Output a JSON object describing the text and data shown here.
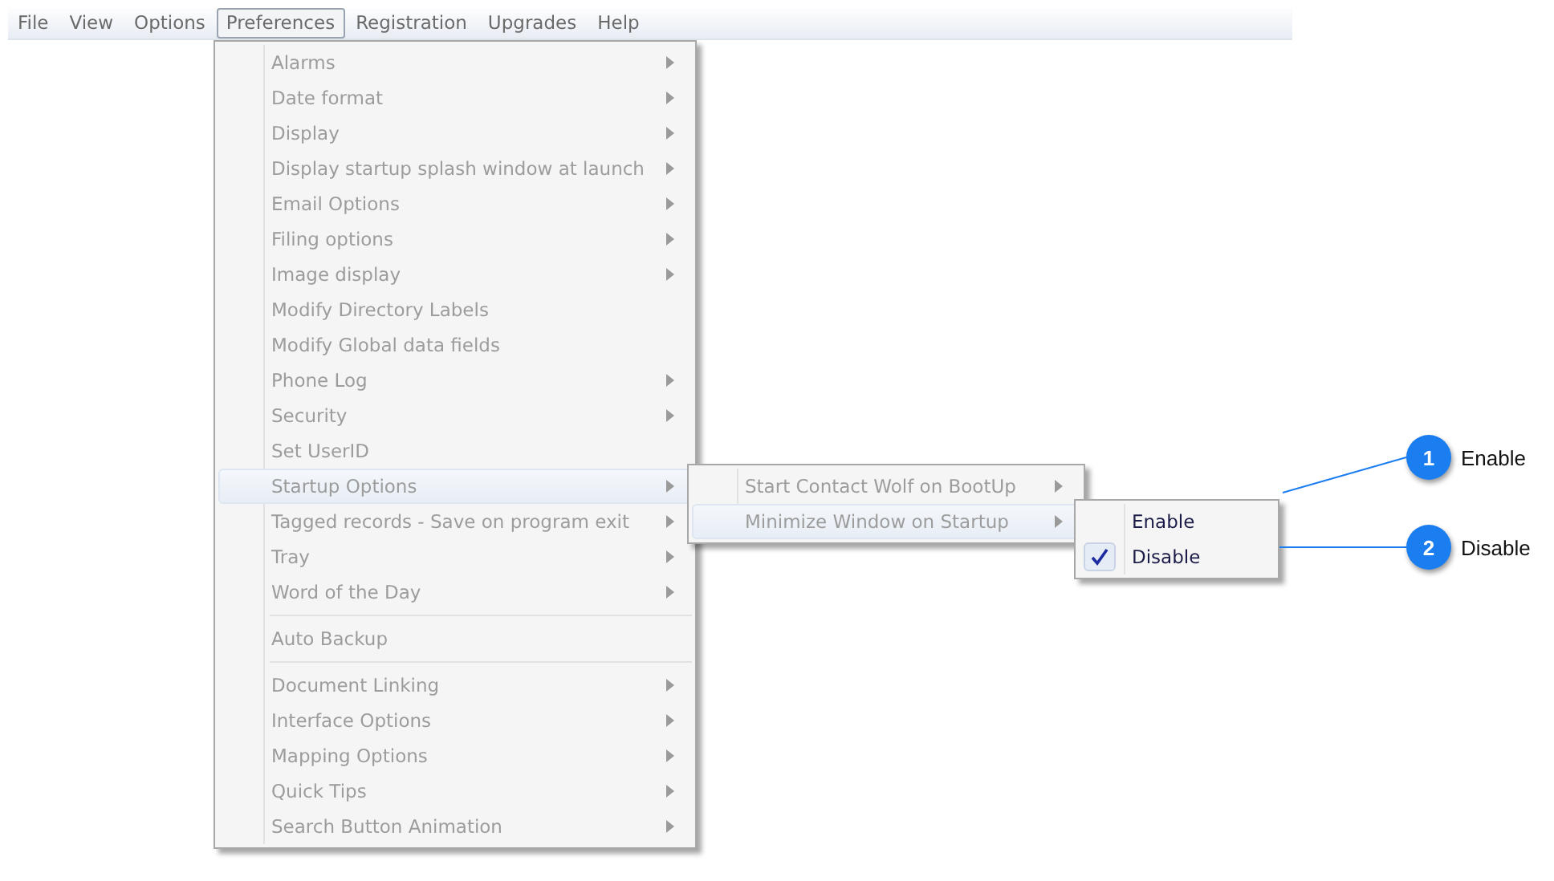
{
  "menu_bar": [
    {
      "label": "File",
      "selected": false
    },
    {
      "label": "View",
      "selected": false
    },
    {
      "label": "Options",
      "selected": false
    },
    {
      "label": "Preferences",
      "selected": true
    },
    {
      "label": "Registration",
      "selected": false
    },
    {
      "label": "Upgrades",
      "selected": false
    },
    {
      "label": "Help",
      "selected": false
    }
  ],
  "preferences_menu": {
    "groups": [
      [
        {
          "label": "Alarms",
          "submenu": true,
          "selected": false
        },
        {
          "label": "Date format",
          "submenu": true,
          "selected": false
        },
        {
          "label": "Display",
          "submenu": true,
          "selected": false
        },
        {
          "label": "Display startup splash window at launch",
          "submenu": true,
          "selected": false
        },
        {
          "label": "Email Options",
          "submenu": true,
          "selected": false
        },
        {
          "label": "Filing options",
          "submenu": true,
          "selected": false
        },
        {
          "label": "Image display",
          "submenu": true,
          "selected": false
        },
        {
          "label": "Modify Directory Labels",
          "submenu": false,
          "selected": false
        },
        {
          "label": "Modify Global data fields",
          "submenu": false,
          "selected": false
        },
        {
          "label": "Phone Log",
          "submenu": true,
          "selected": false
        },
        {
          "label": "Security",
          "submenu": true,
          "selected": false
        },
        {
          "label": "Set UserID",
          "submenu": false,
          "selected": false
        },
        {
          "label": "Startup Options",
          "submenu": true,
          "selected": true
        },
        {
          "label": "Tagged records - Save on program exit",
          "submenu": true,
          "selected": false
        },
        {
          "label": "Tray",
          "submenu": true,
          "selected": false
        },
        {
          "label": "Word of the Day",
          "submenu": true,
          "selected": false
        }
      ],
      [
        {
          "label": "Auto Backup",
          "submenu": false,
          "selected": false
        }
      ],
      [
        {
          "label": "Document Linking",
          "submenu": true,
          "selected": false
        },
        {
          "label": "Interface Options",
          "submenu": true,
          "selected": false
        },
        {
          "label": "Mapping Options",
          "submenu": true,
          "selected": false
        },
        {
          "label": "Quick Tips",
          "submenu": true,
          "selected": false
        },
        {
          "label": "Search Button Animation",
          "submenu": true,
          "selected": false
        }
      ]
    ]
  },
  "startup_submenu": [
    {
      "label": "Start Contact Wolf on BootUp",
      "submenu": true,
      "selected": false
    },
    {
      "label": "Minimize Window on Startup",
      "submenu": true,
      "selected": true
    }
  ],
  "minimize_submenu": [
    {
      "label": "Enable",
      "checked": false
    },
    {
      "label": "Disable",
      "checked": true
    }
  ],
  "callouts": [
    {
      "number": "1",
      "label": "Enable"
    },
    {
      "number": "2",
      "label": "Disable"
    }
  ]
}
